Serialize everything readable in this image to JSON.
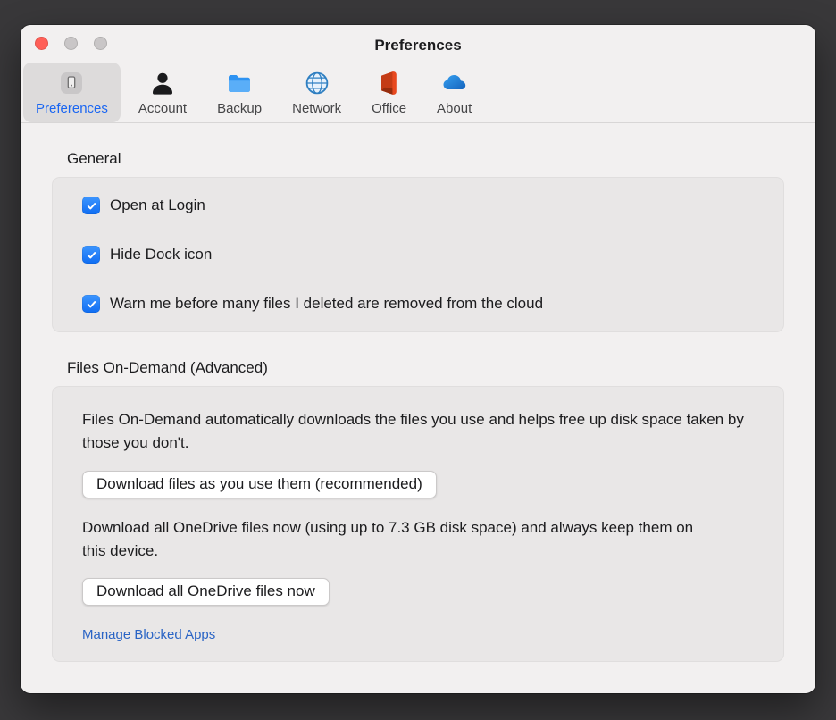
{
  "window": {
    "title": "Preferences"
  },
  "toolbar": {
    "tabs": [
      {
        "label": "Preferences",
        "selected": true
      },
      {
        "label": "Account",
        "selected": false
      },
      {
        "label": "Backup",
        "selected": false
      },
      {
        "label": "Network",
        "selected": false
      },
      {
        "label": "Office",
        "selected": false
      },
      {
        "label": "About",
        "selected": false
      }
    ]
  },
  "general": {
    "heading": "General",
    "checkboxes": [
      {
        "label": "Open at Login",
        "checked": true
      },
      {
        "label": "Hide Dock icon",
        "checked": true
      },
      {
        "label": "Warn me before many files I deleted are removed from the cloud",
        "checked": true
      }
    ]
  },
  "files_on_demand": {
    "heading": "Files On-Demand (Advanced)",
    "description": "Files On-Demand automatically downloads the files you use and helps free up disk space taken by those you don't.",
    "download_as_used_button": "Download files as you use them (recommended)",
    "download_all_description": "Download all OneDrive files now (using up to 7.3 GB disk space) and always keep them on this device.",
    "download_all_button": "Download all OneDrive files now",
    "manage_blocked_apps_link": "Manage Blocked Apps"
  },
  "colors": {
    "accent_blue": "#0d7bff",
    "selected_tab_blue": "#1a66f2",
    "link_blue": "#2a64c5",
    "close_red": "#ff5f57"
  }
}
